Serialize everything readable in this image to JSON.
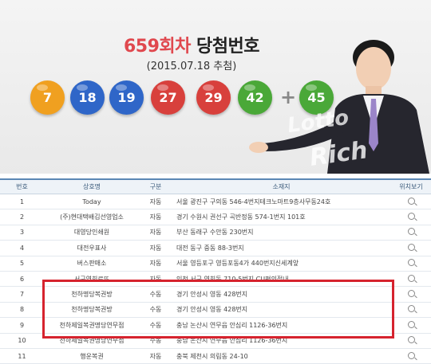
{
  "banner": {
    "round": "659회차",
    "title_suffix": "당첨번호",
    "draw_date": "(2015.07.18 추첨)",
    "numbers": [
      "7",
      "18",
      "19",
      "27",
      "29",
      "42"
    ],
    "plus": "+",
    "bonus": "45",
    "watermark_top": "Lotto",
    "watermark_bottom": "Rich",
    "ball_colors": [
      "#f0a020",
      "#2f66c8",
      "#2f66c8",
      "#d8403c",
      "#d8403c",
      "#4aa838",
      "#4aa838"
    ]
  },
  "table": {
    "headers": [
      "번호",
      "상호명",
      "구분",
      "소재지",
      "위치보기"
    ],
    "rows": [
      {
        "no": "1",
        "name": "Today",
        "type": "자동",
        "addr": "서울 광진구 구의동 546-4번지테크노마트9층사무동24호"
      },
      {
        "no": "2",
        "name": "(주)현대택배김선영업소",
        "type": "자동",
        "addr": "경기 수원시 권선구 곡반정동 574-1번지 101호"
      },
      {
        "no": "3",
        "name": "대영당인쇄원",
        "type": "자동",
        "addr": "부산 동래구 수안동 230번지"
      },
      {
        "no": "4",
        "name": "대전우표사",
        "type": "자동",
        "addr": "대전 동구 중동 88-3번지"
      },
      {
        "no": "5",
        "name": "버스판매소",
        "type": "자동",
        "addr": "서울 영등포구 영등포동4가 440번지신세계앞"
      },
      {
        "no": "6",
        "name": "서구연희로또",
        "type": "자동",
        "addr": "인천 서구 연희동 710-5번지 CU편의점내"
      },
      {
        "no": "7",
        "name": "천하명당복권방",
        "type": "수동",
        "addr": "경기 안성시 영동 428번지"
      },
      {
        "no": "8",
        "name": "천하명당복권방",
        "type": "수동",
        "addr": "경기 안성시 영동 428번지"
      },
      {
        "no": "9",
        "name": "천하제일복권명당연무점",
        "type": "수동",
        "addr": "충남 논산시 연무읍 안심리 1126-36번지"
      },
      {
        "no": "10",
        "name": "천하제일복권명당연무점",
        "type": "수동",
        "addr": "충남 논산시 연무읍 안심리 1126-36번지"
      },
      {
        "no": "11",
        "name": "행운복권",
        "type": "자동",
        "addr": "충북 제천시 의림동 24-10"
      }
    ]
  }
}
